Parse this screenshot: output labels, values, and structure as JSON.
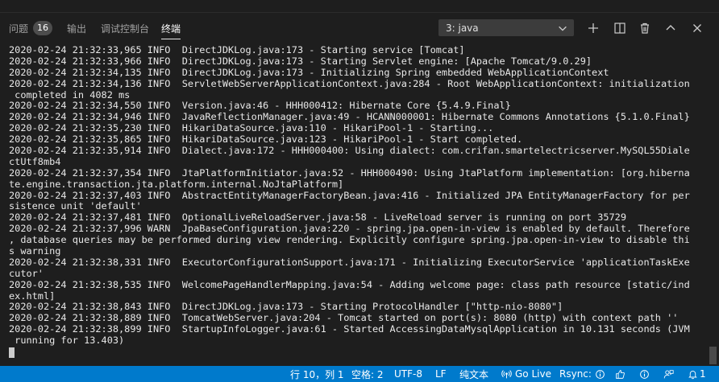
{
  "tabs": [
    {
      "label": "问题",
      "count": "16"
    },
    {
      "label": "输出"
    },
    {
      "label": "调试控制台"
    },
    {
      "label": "终端",
      "active": true
    }
  ],
  "terminal_select": {
    "value": "3: java"
  },
  "toolbar": {
    "icons": [
      "add-icon",
      "split-icon",
      "trash-icon",
      "chevron-up-icon",
      "close-icon"
    ]
  },
  "terminal_lines": [
    "2020-02-24 21:32:33,965 INFO  DirectJDKLog.java:173 - Starting service [Tomcat]",
    "2020-02-24 21:32:33,966 INFO  DirectJDKLog.java:173 - Starting Servlet engine: [Apache Tomcat/9.0.29]",
    "2020-02-24 21:32:34,135 INFO  DirectJDKLog.java:173 - Initializing Spring embedded WebApplicationContext",
    "2020-02-24 21:32:34,136 INFO  ServletWebServerApplicationContext.java:284 - Root WebApplicationContext: initialization",
    " completed in 4082 ms",
    "2020-02-24 21:32:34,550 INFO  Version.java:46 - HHH000412: Hibernate Core {5.4.9.Final}",
    "2020-02-24 21:32:34,946 INFO  JavaReflectionManager.java:49 - HCANN000001: Hibernate Commons Annotations {5.1.0.Final}",
    "2020-02-24 21:32:35,230 INFO  HikariDataSource.java:110 - HikariPool-1 - Starting...",
    "2020-02-24 21:32:35,865 INFO  HikariDataSource.java:123 - HikariPool-1 - Start completed.",
    "2020-02-24 21:32:35,914 INFO  Dialect.java:172 - HHH000400: Using dialect: com.crifan.smartelectricserver.MySQL55Diale",
    "ctUtf8mb4",
    "2020-02-24 21:32:37,354 INFO  JtaPlatformInitiator.java:52 - HHH000490: Using JtaPlatform implementation: [org.hiberna",
    "te.engine.transaction.jta.platform.internal.NoJtaPlatform]",
    "2020-02-24 21:32:37,403 INFO  AbstractEntityManagerFactoryBean.java:416 - Initialized JPA EntityManagerFactory for per",
    "sistence unit 'default'",
    "2020-02-24 21:32:37,481 INFO  OptionalLiveReloadServer.java:58 - LiveReload server is running on port 35729",
    "2020-02-24 21:32:37,996 WARN  JpaBaseConfiguration.java:220 - spring.jpa.open-in-view is enabled by default. Therefore",
    ", database queries may be performed during view rendering. Explicitly configure spring.jpa.open-in-view to disable thi",
    "s warning",
    "2020-02-24 21:32:38,331 INFO  ExecutorConfigurationSupport.java:171 - Initializing ExecutorService 'applicationTaskExe",
    "cutor'",
    "2020-02-24 21:32:38,535 INFO  WelcomePageHandlerMapping.java:54 - Adding welcome page: class path resource [static/ind",
    "ex.html]",
    "2020-02-24 21:32:38,843 INFO  DirectJDKLog.java:173 - Starting ProtocolHandler [\"http-nio-8080\"]",
    "2020-02-24 21:32:38,889 INFO  TomcatWebServer.java:204 - Tomcat started on port(s): 8080 (http) with context path ''",
    "2020-02-24 21:32:38,899 INFO  StartupInfoLogger.java:61 - Started AccessingDataMysqlApplication in 10.131 seconds (JVM",
    " running for 13.403)"
  ],
  "statusbar": {
    "position": "行 10，列 1",
    "indent": "空格: 2",
    "encoding": "UTF-8",
    "eol": "LF",
    "language": "纯文本",
    "golive": "Go Live",
    "rsync": "Rsync:",
    "bell_count": "1",
    "icons": [
      "broadcast-icon",
      "info-icon",
      "thumbs-up-icon",
      "info-icon",
      "person-feedback-icon",
      "bell-icon"
    ]
  },
  "colors": {
    "background": "#1e1e1e",
    "statusbar": "#007acc",
    "text": "#e8e8e8"
  }
}
